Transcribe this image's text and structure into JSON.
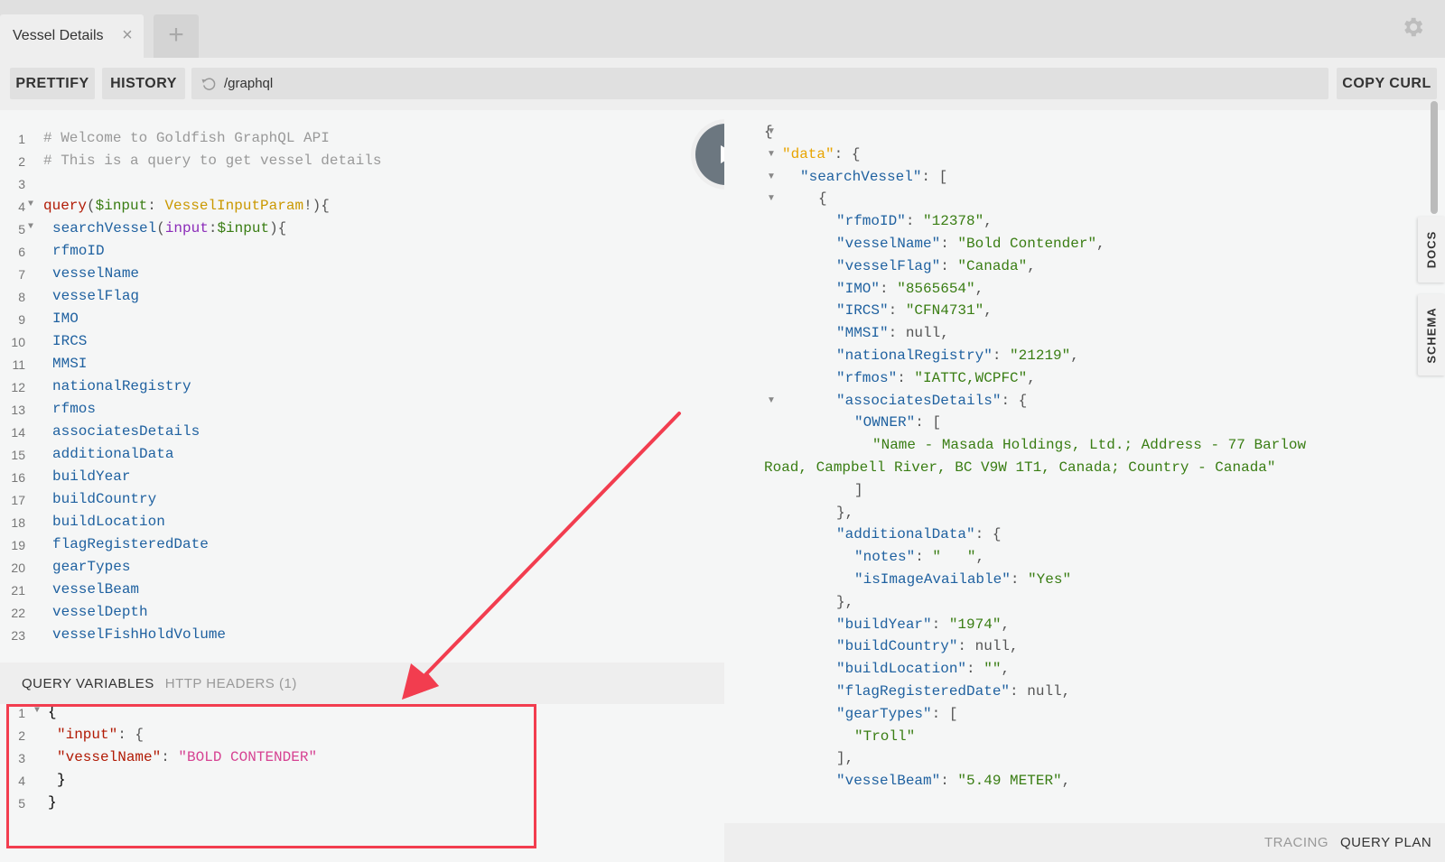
{
  "tabs": [
    {
      "label": "Vessel Details"
    }
  ],
  "toolbar": {
    "prettify": "PRETTIFY",
    "history": "HISTORY",
    "url": "/graphql",
    "copy_curl": "COPY CURL"
  },
  "editor": {
    "lines": [
      {
        "n": "1",
        "text": "# Welcome to Goldfish GraphQL API"
      },
      {
        "n": "2",
        "text": "# This is a query to get vessel details"
      },
      {
        "n": "3",
        "text": ""
      },
      {
        "n": "4",
        "k": "query",
        "v": "$input",
        "t": "VesselInputParam",
        "end": "!){"
      },
      {
        "n": "5",
        "f": "searchVessel",
        "a": "input",
        "v": "$input",
        "end": "){"
      },
      {
        "n": "6",
        "field": "rfmoID"
      },
      {
        "n": "7",
        "field": "vesselName"
      },
      {
        "n": "8",
        "field": "vesselFlag"
      },
      {
        "n": "9",
        "field": "IMO"
      },
      {
        "n": "10",
        "field": "IRCS"
      },
      {
        "n": "11",
        "field": "MMSI"
      },
      {
        "n": "12",
        "field": "nationalRegistry"
      },
      {
        "n": "13",
        "field": "rfmos"
      },
      {
        "n": "14",
        "field": "associatesDetails"
      },
      {
        "n": "15",
        "field": "additionalData"
      },
      {
        "n": "16",
        "field": "buildYear"
      },
      {
        "n": "17",
        "field": "buildCountry"
      },
      {
        "n": "18",
        "field": "buildLocation"
      },
      {
        "n": "19",
        "field": "flagRegisteredDate"
      },
      {
        "n": "20",
        "field": "gearTypes"
      },
      {
        "n": "21",
        "field": "vesselBeam"
      },
      {
        "n": "22",
        "field": "vesselDepth"
      },
      {
        "n": "23",
        "field": "vesselFishHoldVolume"
      }
    ]
  },
  "variables": {
    "tabs": {
      "query_variables": "QUERY VARIABLES",
      "http_headers": "HTTP HEADERS (1)"
    },
    "json": {
      "input_key": "\"input\"",
      "name_key": "\"vesselName\"",
      "name_value": "\"BOLD CONTENDER\""
    }
  },
  "result": {
    "data_key": "\"data\"",
    "search_key": "\"searchVessel\"",
    "fields": [
      {
        "k": "\"rfmoID\"",
        "v": "\"12378\""
      },
      {
        "k": "\"vesselName\"",
        "v": "\"Bold Contender\""
      },
      {
        "k": "\"vesselFlag\"",
        "v": "\"Canada\""
      },
      {
        "k": "\"IMO\"",
        "v": "\"8565654\""
      },
      {
        "k": "\"IRCS\"",
        "v": "\"CFN4731\""
      },
      {
        "k": "\"MMSI\"",
        "v": "null"
      },
      {
        "k": "\"nationalRegistry\"",
        "v": "\"21219\""
      },
      {
        "k": "\"rfmos\"",
        "v": "\"IATTC,WCPFC\""
      }
    ],
    "associates_key": "\"associatesDetails\"",
    "owner_key": "\"OWNER\"",
    "owner_value_1": "\"Name - Masada Holdings, Ltd.; Address - 77 Barlow",
    "owner_value_2": "Road, Campbell River, BC V9W 1T1, Canada; Country - Canada\"",
    "additional_key": "\"additionalData\"",
    "notes_key": "\"notes\"",
    "notes_value": "\"   \"",
    "image_key": "\"isImageAvailable\"",
    "image_value": "\"Yes\"",
    "fields2": [
      {
        "k": "\"buildYear\"",
        "v": "\"1974\""
      },
      {
        "k": "\"buildCountry\"",
        "v": "null"
      },
      {
        "k": "\"buildLocation\"",
        "v": "\"\""
      },
      {
        "k": "\"flagRegisteredDate\"",
        "v": "null"
      }
    ],
    "gear_key": "\"gearTypes\"",
    "gear_value": "\"Troll\"",
    "beam_key": "\"vesselBeam\"",
    "beam_value": "\"5.49 METER\""
  },
  "side_tabs": {
    "docs": "DOCS",
    "schema": "SCHEMA"
  },
  "footer": {
    "tracing": "TRACING",
    "query_plan": "QUERY PLAN"
  },
  "colors": {
    "accent_red": "#f23d4f",
    "play_button": "#6c7780"
  }
}
